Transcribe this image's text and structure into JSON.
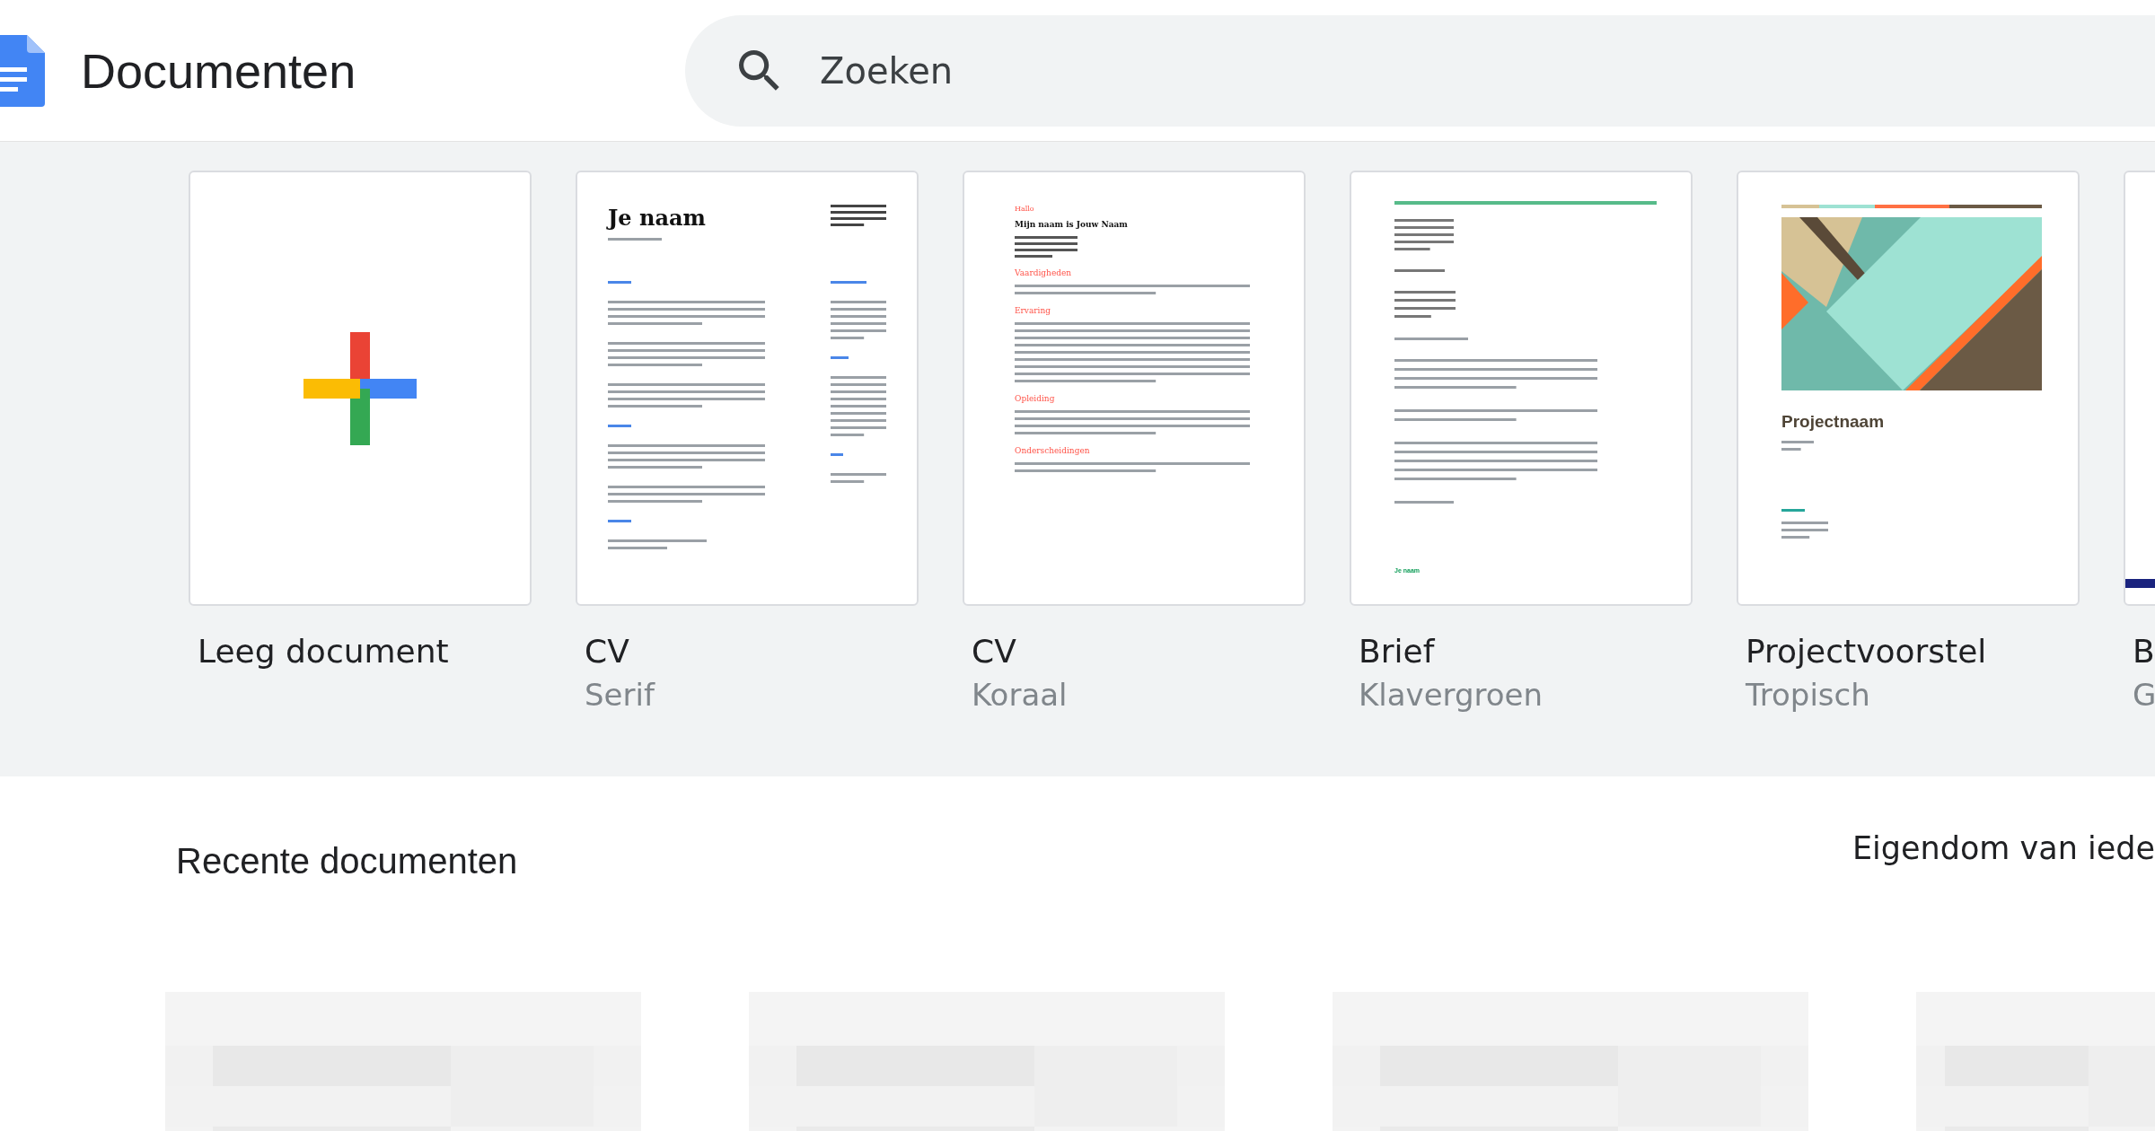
{
  "header": {
    "title": "Documenten",
    "search": {
      "placeholder": "Zoeken"
    }
  },
  "templates": [
    {
      "kind": "blank",
      "title": "Leeg document"
    },
    {
      "kind": "cv-serif",
      "title": "CV",
      "subtitle": "Serif",
      "preview": {
        "heading": "Je naam"
      }
    },
    {
      "kind": "cv-coral",
      "title": "CV",
      "subtitle": "Koraal",
      "preview": {
        "greeting": "Hallo",
        "heading": "Mijn naam is Jouw Naam",
        "sections": [
          "Vaardigheden",
          "Ervaring",
          "Opleiding",
          "Onderscheidingen"
        ]
      }
    },
    {
      "kind": "letter",
      "title": "Brief",
      "subtitle": "Klavergroen",
      "preview": {
        "signature": "Je naam"
      }
    },
    {
      "kind": "project",
      "title": "Projectvoorstel",
      "subtitle": "Tropisch",
      "preview": {
        "heading": "Projectnaam"
      }
    },
    {
      "kind": "partial",
      "title": "B",
      "subtitle": "G"
    }
  ],
  "recent": {
    "title": "Recente documenten",
    "owner_filter": "Eigendom van iede"
  }
}
